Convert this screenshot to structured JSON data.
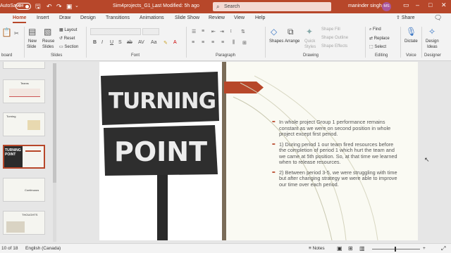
{
  "titlebar": {
    "autosave": "AutoSave",
    "autosave_state": "Off",
    "filename": "Sim4projects_G1_...",
    "modified": "Last Modified: 5h ago",
    "search_placeholder": "Search",
    "user": "maninder singh",
    "initials": "MS"
  },
  "tabs": [
    "Home",
    "Insert",
    "Draw",
    "Design",
    "Transitions",
    "Animations",
    "Slide Show",
    "Review",
    "View",
    "Help"
  ],
  "share_label": "Share",
  "ribbon": {
    "clipboard_label": "board",
    "new_slide": "New",
    "new_slide2": "Slide",
    "reuse": "Reuse",
    "reuse2": "Slides",
    "layout": "Layout",
    "reset": "Reset",
    "section": "Section",
    "slides_label": "Slides",
    "font_label": "Font",
    "paragraph_label": "Paragraph",
    "shapes": "Shapes",
    "arrange": "Arrange",
    "quick": "Quick",
    "styles": "Styles",
    "shape_fill": "Shape Fill",
    "shape_outline": "Shape Outline",
    "shape_effects": "Shape Effects",
    "drawing_label": "Drawing",
    "find": "Find",
    "replace": "Replace",
    "select": "Select",
    "editing_label": "Editing",
    "dictate": "Dictate",
    "voice_label": "Voice",
    "design": "Design",
    "ideas": "Ideas",
    "designer_label": "Designer"
  },
  "slide": {
    "sign_line1": "TURNING",
    "sign_line2": "POINT",
    "bullets": [
      "In whole project Group 1 performance remains constant as we were on second position in whole project except first period.",
      "1) During period 1 our team fired resources before the completion of period 1 which hurt the team and we came at 5th position. So, at that time we learned when to release resources.",
      "2) Between period 3-5, we were struggling with time but after changing strategy we were able to improve our time over each period."
    ]
  },
  "thumbnails": {
    "numbers": [
      "",
      "",
      "",
      "",
      "",
      ""
    ],
    "titles": [
      "Teams",
      "Turning",
      "TURNING POINT",
      "Continuous",
      "THOUGHTS"
    ],
    "selected": 3
  },
  "statusbar": {
    "slide_count": "10 of 18",
    "language": "English (Canada)",
    "notes": "Notes"
  },
  "colors": {
    "accent": "#b7472a",
    "divider": "#7a6c58"
  }
}
